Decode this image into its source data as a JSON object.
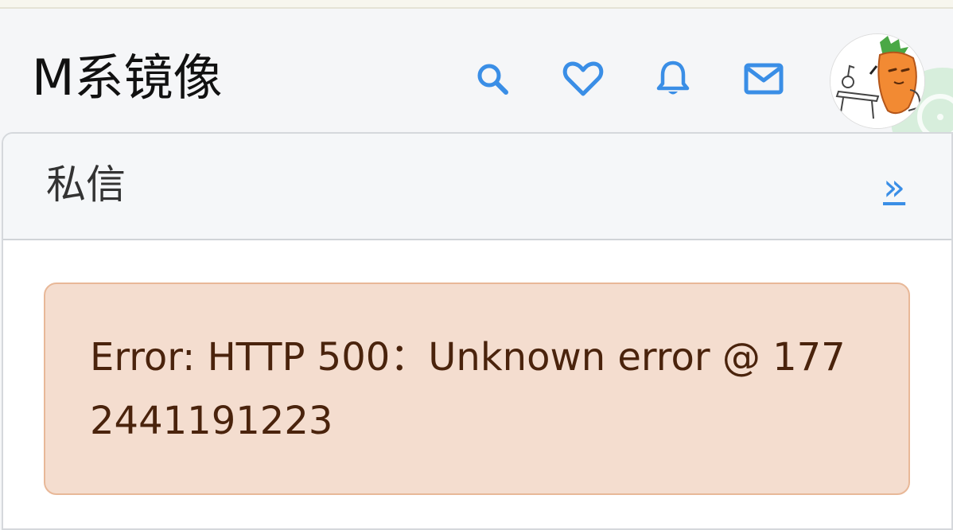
{
  "header": {
    "site_title": "M系镜像",
    "icons": [
      "search-icon",
      "heart-icon",
      "bell-icon",
      "mail-icon"
    ],
    "accent_color": "#3a8ee6"
  },
  "panel": {
    "title": "私信",
    "more_link": "»"
  },
  "error": {
    "message": "Error: HTTP 500：Unknown error @ 1772441191223",
    "background": "#f4ddcf",
    "text_color": "#4a230c"
  }
}
